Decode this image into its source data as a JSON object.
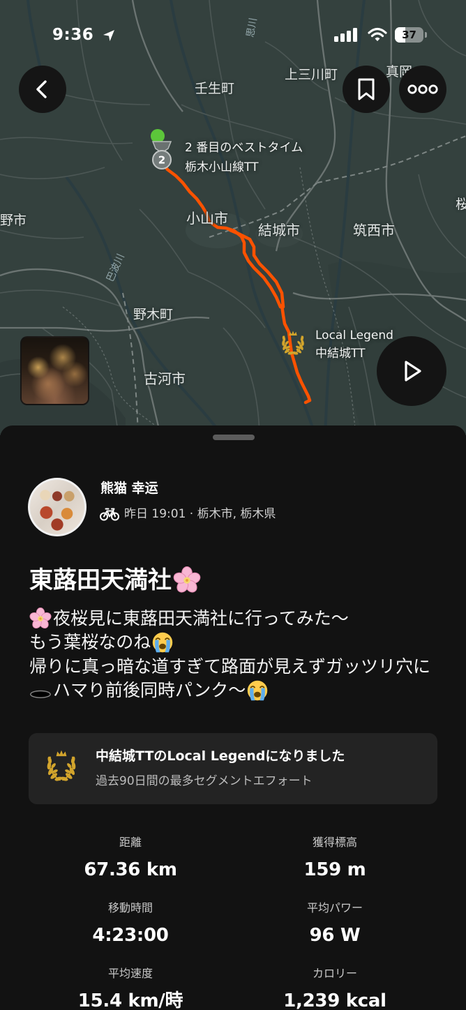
{
  "status_bar": {
    "time": "9:36",
    "battery_level": "37",
    "icons": [
      "location-arrow-icon",
      "cellular-signal-icon",
      "wifi-icon",
      "battery-icon"
    ]
  },
  "map": {
    "places": {
      "mibu": "壬生町",
      "kaminokawa": "上三川町",
      "moka": "真岡",
      "sakura_partial": "桜",
      "sano_partial": "野市",
      "oyama": "小山市",
      "yuki": "結城市",
      "chikusei": "筑西市",
      "nogi": "野木町",
      "koga": "古河市"
    },
    "rivers": {
      "uzuma": "巴波川",
      "omoi": "思川"
    },
    "segment_achievement": {
      "rank": "2",
      "title": "2 番目のベストタイム",
      "segment": "栃木小山線TT"
    },
    "local_legend": {
      "title": "Local Legend",
      "segment": "中結城TT"
    }
  },
  "toolbar": {
    "back_icon": "chevron-left-icon",
    "bookmark_icon": "bookmark-icon",
    "more_icon": "more-dots-icon",
    "play_icon": "play-icon"
  },
  "activity": {
    "athlete_name": "熊猫 幸运",
    "sport_icon": "bike-icon",
    "meta": "昨日 19:01 · 栃木市, 栃木県",
    "title": "東蕗田天満社",
    "title_emoji": "cherry-blossom-emoji",
    "description": {
      "line1": "夜桜見に東蕗田天満社に行ってみた〜",
      "line2": "もう葉桜なのね",
      "line3": "帰りに真っ暗な道すぎて路面が見えずガッツリ穴に",
      "line4": "ハマり前後同時パンク〜"
    }
  },
  "achievement_card": {
    "icon": "laurel-icon",
    "title": "中結城TTのLocal Legendになりました",
    "subtitle": "過去90日間の最多セグメントエフォート"
  },
  "stats": [
    {
      "label": "距離",
      "value": "67.36 km"
    },
    {
      "label": "獲得標高",
      "value": "159 m"
    },
    {
      "label": "移動時間",
      "value": "4:23:00"
    },
    {
      "label": "平均パワー",
      "value": "96 W"
    },
    {
      "label": "平均速度",
      "value": "15.4 km/時"
    },
    {
      "label": "カロリー",
      "value": "1,239 kcal"
    }
  ],
  "colors": {
    "route": "#fc5200",
    "start_marker": "#5cc63a",
    "local_legend_gold": "#d2a42c",
    "map_background": "#34413e",
    "sheet_background": "#121212",
    "card_background": "#232323"
  }
}
